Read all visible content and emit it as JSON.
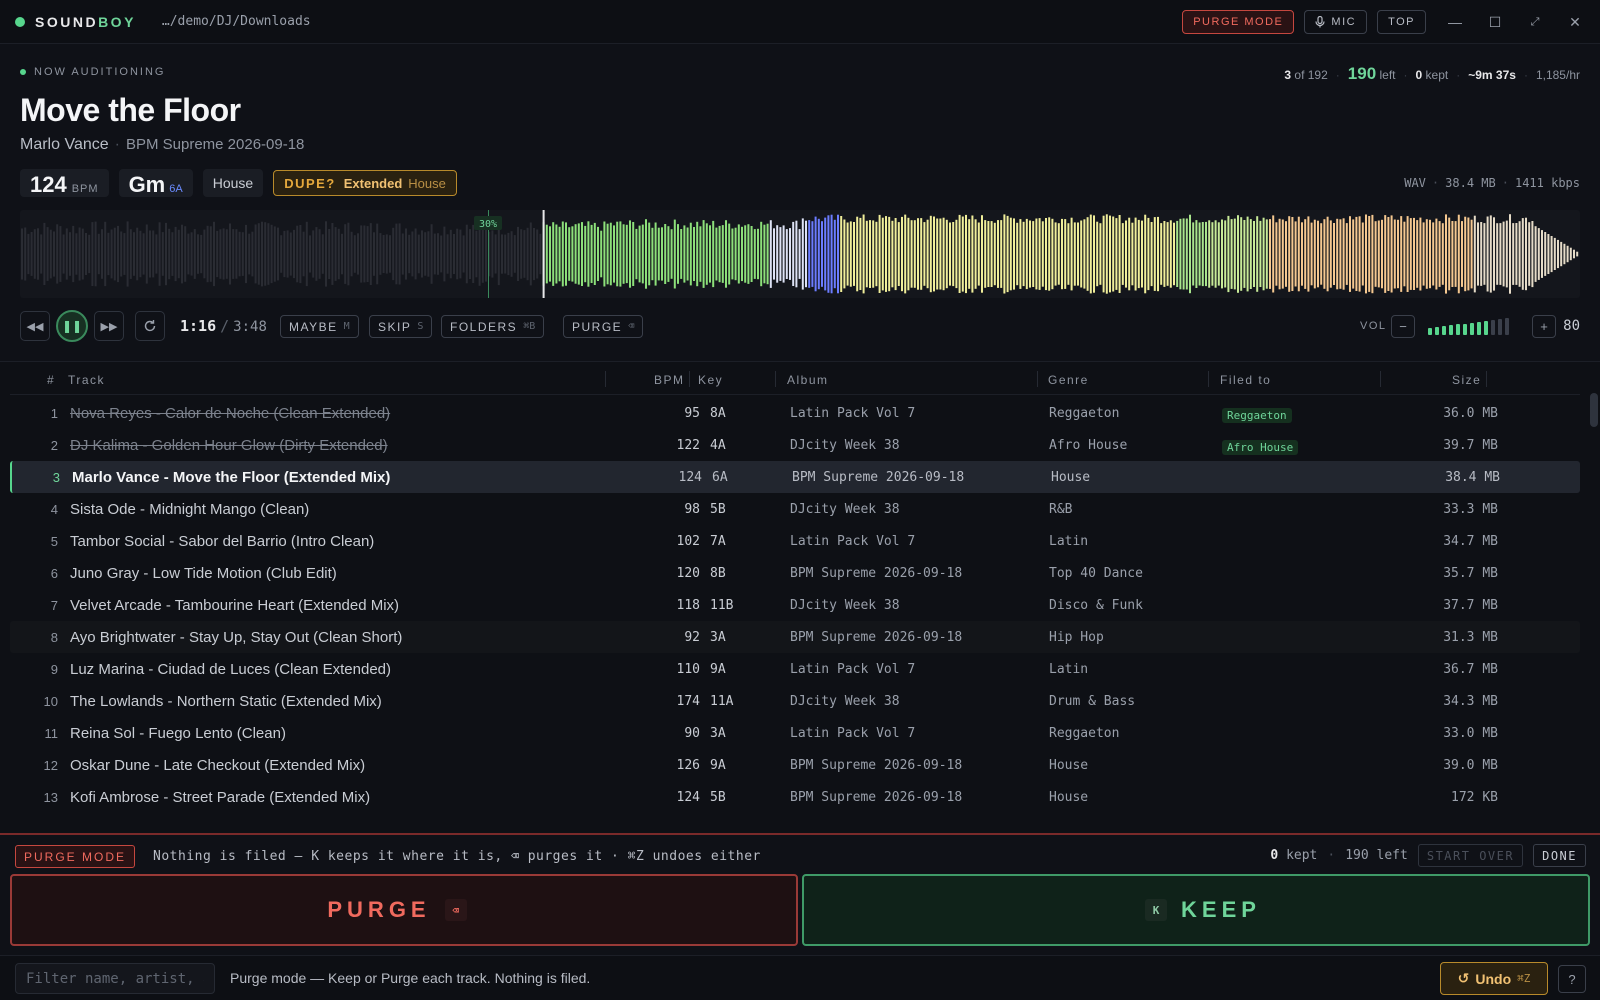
{
  "app": {
    "brand_a": "SOUND",
    "brand_b": "BOY",
    "path": "…/demo/DJ/Downloads",
    "purge_mode_label": "PURGE MODE",
    "mic_label": "MIC",
    "top_label": "TOP"
  },
  "now": {
    "label": "NOW AUDITIONING",
    "title": "Move the Floor",
    "artist": "Marlo Vance",
    "album": "BPM Supreme 2026-09-18",
    "bpm": "124",
    "bpm_unit": "BPM",
    "key": "Gm",
    "camelot": "6A",
    "genre": "House",
    "dupe_label": "DUPE?",
    "dupe_version": "Extended",
    "dupe_genre": "House",
    "format": "WAV",
    "filesize": "38.4 MB",
    "bitrate": "1411 kbps",
    "waveform_marker": "30%",
    "played_fraction": 0.335,
    "elapsed": "1:16",
    "duration": "3:48"
  },
  "stats": {
    "position": "3",
    "of_total": "of 192",
    "left_count": "190",
    "left_label": "left",
    "kept_count": "0",
    "kept_label": "kept",
    "eta": "~9m 37s",
    "rate": "1,185/hr"
  },
  "actions": {
    "maybe": "MAYBE",
    "maybe_kb": "M",
    "skip": "SKIP",
    "skip_kb": "S",
    "folders": "FOLDERS",
    "folders_kb": "⌘B",
    "purge": "PURGE",
    "purge_kb": "⌫",
    "vol_label": "VOL",
    "volume": "80",
    "volume_level": 0.8
  },
  "table": {
    "headers": {
      "num": "#",
      "track": "Track",
      "bpm": "BPM",
      "key": "Key",
      "album": "Album",
      "genre": "Genre",
      "filed": "Filed to",
      "size": "Size"
    },
    "rows": [
      {
        "n": "1",
        "name": "Nova Reyes - Calor de Noche (Clean Extended)",
        "bpm": "95",
        "key": "8A",
        "album": "Latin Pack Vol 7",
        "genre": "Reggaeton",
        "filed": "Reggaeton",
        "size": "36.0 MB",
        "state": "purged"
      },
      {
        "n": "2",
        "name": "DJ Kalima - Golden Hour Glow (Dirty Extended)",
        "bpm": "122",
        "key": "4A",
        "album": "DJcity Week 38",
        "genre": "Afro House",
        "filed": "Afro House",
        "size": "39.7 MB",
        "state": "purged"
      },
      {
        "n": "3",
        "name": "Marlo Vance - Move the Floor (Extended Mix)",
        "bpm": "124",
        "key": "6A",
        "album": "BPM Supreme 2026-09-18",
        "genre": "House",
        "filed": "",
        "size": "38.4 MB",
        "state": "selected"
      },
      {
        "n": "4",
        "name": "Sista Ode - Midnight Mango (Clean)",
        "bpm": "98",
        "key": "5B",
        "album": "DJcity Week 38",
        "genre": "R&B",
        "filed": "",
        "size": "33.3 MB",
        "state": ""
      },
      {
        "n": "5",
        "name": "Tambor Social - Sabor del Barrio (Intro Clean)",
        "bpm": "102",
        "key": "7A",
        "album": "Latin Pack Vol 7",
        "genre": "Latin",
        "filed": "",
        "size": "34.7 MB",
        "state": ""
      },
      {
        "n": "6",
        "name": "Juno Gray - Low Tide Motion (Club Edit)",
        "bpm": "120",
        "key": "8B",
        "album": "BPM Supreme 2026-09-18",
        "genre": "Top 40 Dance",
        "filed": "",
        "size": "35.7 MB",
        "state": ""
      },
      {
        "n": "7",
        "name": "Velvet Arcade - Tambourine Heart (Extended Mix)",
        "bpm": "118",
        "key": "11B",
        "album": "DJcity Week 38",
        "genre": "Disco & Funk",
        "filed": "",
        "size": "37.7 MB",
        "state": ""
      },
      {
        "n": "8",
        "name": "Ayo Brightwater - Stay Up, Stay Out (Clean Short)",
        "bpm": "92",
        "key": "3A",
        "album": "BPM Supreme 2026-09-18",
        "genre": "Hip Hop",
        "filed": "",
        "size": "31.3 MB",
        "state": "alt"
      },
      {
        "n": "9",
        "name": "Luz Marina - Ciudad de Luces (Clean Extended)",
        "bpm": "110",
        "key": "9A",
        "album": "Latin Pack Vol 7",
        "genre": "Latin",
        "filed": "",
        "size": "36.7 MB",
        "state": ""
      },
      {
        "n": "10",
        "name": "The Lowlands - Northern Static (Extended Mix)",
        "bpm": "174",
        "key": "11A",
        "album": "DJcity Week 38",
        "genre": "Drum & Bass",
        "filed": "",
        "size": "34.3 MB",
        "state": ""
      },
      {
        "n": "11",
        "name": "Reina Sol - Fuego Lento (Clean)",
        "bpm": "90",
        "key": "3A",
        "album": "Latin Pack Vol 7",
        "genre": "Reggaeton",
        "filed": "",
        "size": "33.0 MB",
        "state": ""
      },
      {
        "n": "12",
        "name": "Oskar Dune - Late Checkout (Extended Mix)",
        "bpm": "126",
        "key": "9A",
        "album": "BPM Supreme 2026-09-18",
        "genre": "House",
        "filed": "",
        "size": "39.0 MB",
        "state": ""
      },
      {
        "n": "13",
        "name": "Kofi Ambrose - Street Parade (Extended Mix)",
        "bpm": "124",
        "key": "5B",
        "album": "BPM Supreme 2026-09-18",
        "genre": "House",
        "filed": "",
        "size": "172 KB",
        "state": ""
      }
    ]
  },
  "purgebar": {
    "badge": "PURGE MODE",
    "text": "Nothing is filed — K keeps it where it is, ⌫ purges it · ⌘Z undoes either",
    "kept_count": "0",
    "kept_label": "kept",
    "left_text": "190 left",
    "start_over": "START OVER",
    "done": "DONE",
    "purge_label": "PURGE",
    "purge_kb": "⌫",
    "keep_label": "KEEP",
    "keep_kb": "K"
  },
  "footer": {
    "filter_placeholder": "Filter name, artist, a",
    "message": "Purge mode — Keep or Purge each track. Nothing is filed.",
    "undo": "Undo",
    "undo_kb": "⌘Z",
    "help": "?"
  },
  "colors": {
    "accent_green": "#57d68d",
    "purge_red": "#f06a5e",
    "dupe_amber": "#e5a83c",
    "waveform_played": "#2a2c33",
    "waveform_green": "#8de07a",
    "waveform_blue": "#6b7cff",
    "waveform_yellow": "#f0ee9a",
    "waveform_orange": "#f5c890"
  }
}
